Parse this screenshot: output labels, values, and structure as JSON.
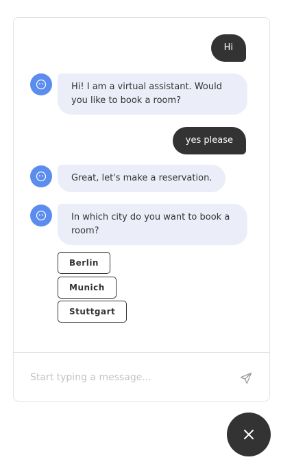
{
  "conversation": {
    "messages": [
      {
        "sender": "user",
        "text": "Hi"
      },
      {
        "sender": "bot",
        "text": "Hi! I am a virtual assistant. Would you like to book a room?"
      },
      {
        "sender": "user",
        "text": "yes please"
      },
      {
        "sender": "bot",
        "text": "Great, let's make a reservation."
      },
      {
        "sender": "bot",
        "text": "In which city do you want to book a room?"
      }
    ],
    "quick_replies": [
      "Berlin",
      "Munich",
      "Stuttgart"
    ]
  },
  "composer": {
    "placeholder": "Start typing a message...",
    "value": ""
  },
  "icons": {
    "bot_avatar": "bot-face-icon",
    "send": "paper-plane-icon",
    "launcher": "close-icon"
  },
  "colors": {
    "user_bubble": "#333333",
    "bot_bubble": "#ebeef8",
    "avatar": "#5b8def",
    "launcher": "#333333"
  }
}
